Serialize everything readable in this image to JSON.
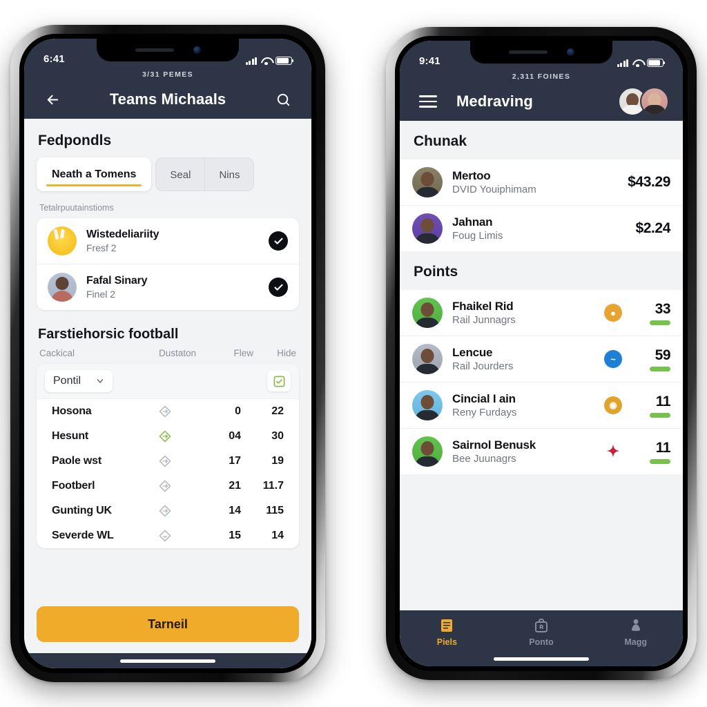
{
  "left_phone": {
    "status_bar": {
      "time": "6:41",
      "signal_icon": "cellular-bars-icon",
      "wifi_icon": "wifi-icon",
      "battery_icon": "battery-icon"
    },
    "header": {
      "sub_count": "3/31 PEMES",
      "title": "Teams Michaals",
      "back_icon": "arrow-left-icon",
      "search_icon": "search-icon"
    },
    "section_title": "Fedpondls",
    "tabs": [
      {
        "label": "Neath a Tomens",
        "active": true
      },
      {
        "label": "Seal",
        "active": false
      },
      {
        "label": "Nins",
        "active": false
      }
    ],
    "list_caption": "Tetalrpuutainstioms",
    "players": [
      {
        "name": "Wistedeliariity",
        "sub": "Fresf 2",
        "avatar": "jersey-avatar",
        "checked": true
      },
      {
        "name": "Fafal Sinary",
        "sub": "Finel 2",
        "avatar": "person-avatar",
        "checked": true
      }
    ],
    "table": {
      "title": "Farstiehorsic football",
      "columns": [
        "Cackical",
        "Dustaton",
        "Flew",
        "Hide"
      ],
      "select_value": "Pontil",
      "select_chevron_icon": "chevron-down-icon",
      "checkbox_icon": "check-square-icon",
      "rows": [
        {
          "name": "Hosona",
          "icon": "diamond-grey-icon",
          "flew": "0",
          "hide": "22"
        },
        {
          "name": "Hesunt",
          "icon": "diamond-green-icon",
          "flew": "04",
          "hide": "30"
        },
        {
          "name": "Paole wst",
          "icon": "diamond-grey-icon",
          "flew": "17",
          "hide": "19"
        },
        {
          "name": "Footberl",
          "icon": "diamond-grey-icon",
          "flew": "21",
          "hide": "11.7"
        },
        {
          "name": "Gunting UK",
          "icon": "diamond-grey-icon",
          "flew": "14",
          "hide": "115"
        },
        {
          "name": "Severde WL",
          "icon": "diamond-grey-icon",
          "flew": "15",
          "hide": "14"
        }
      ]
    },
    "cta_label": "Tarneil"
  },
  "right_phone": {
    "status_bar": {
      "time": "9:41",
      "signal_icon": "cellular-bars-icon",
      "wifi_icon": "wifi-icon",
      "battery_icon": "battery-icon"
    },
    "header": {
      "sub_count": "2,311 FOINES",
      "title": "Medraving",
      "menu_icon": "hamburger-menu-icon",
      "avatars": [
        "user-avatar-1",
        "user-avatar-2"
      ]
    },
    "sections": [
      {
        "heading": "Chunak",
        "rows": [
          {
            "name": "Mertoo",
            "sub": "DVID Youiphimam",
            "amount": "$43.29"
          },
          {
            "name": "Jahnan",
            "sub": "Foug Limis",
            "amount": "$2.24"
          }
        ]
      }
    ],
    "points": {
      "heading": "Points",
      "rows": [
        {
          "name": "Fhaikel Rid",
          "sub": "Rail Junnagrs",
          "badge_icon": "flame-badge-icon",
          "badge_color": "#e8a433",
          "value": "33"
        },
        {
          "name": "Lencue",
          "sub": "Rail Jourders",
          "badge_icon": "wave-badge-icon",
          "badge_color": "#1d7fd6",
          "value": "59"
        },
        {
          "name": "Cincial I ain",
          "sub": "Reny Furdays",
          "badge_icon": "spiral-badge-icon",
          "badge_color": "#e0a42c",
          "value": "11"
        },
        {
          "name": "Sairnol Benusk",
          "sub": "Bee Juunagrs",
          "badge_icon": "star-badge-icon",
          "badge_color": "#c8203a",
          "value": "11"
        }
      ],
      "bar_color": "#76c24a"
    },
    "tabs": [
      {
        "label": "Piels",
        "icon": "list-book-icon",
        "active": true
      },
      {
        "label": "Ponto",
        "icon": "bag-icon",
        "active": false
      },
      {
        "label": "Magg",
        "icon": "person-icon",
        "active": false
      }
    ]
  },
  "theme": {
    "header_navy": "#2d3546",
    "accent_amber": "#f1ab2a",
    "page_grey": "#f2f3f5",
    "green": "#76c24a"
  }
}
